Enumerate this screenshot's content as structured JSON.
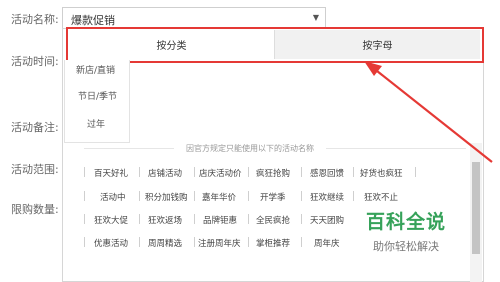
{
  "form": {
    "labels": {
      "activity_name": "活动名称:",
      "activity_time": "活动时间:",
      "activity_remark": "活动备注:",
      "activity_scope": "活动范围:",
      "limit_quantity": "限购数量:"
    },
    "activity_select_value": "爆款促销"
  },
  "tabs": [
    {
      "label": "按分类"
    },
    {
      "label": "按字母"
    }
  ],
  "categories": [
    "新店/直销",
    "节日/季节",
    "过年"
  ],
  "section_title": "因官方规定只能使用以下的活动名称",
  "tag_rows": [
    [
      "百天好礼",
      "店铺活动",
      "店庆活动价",
      "疯狂抢购",
      "感恩回馈",
      "好货也疯狂"
    ],
    [
      "活动中",
      "积分加钱购",
      "嘉年华价",
      "开学季",
      "狂欢继续",
      "狂欢不止"
    ],
    [
      "狂欢大促",
      "狂欢返场",
      "品牌钜惠",
      "全民疯抢",
      "天天团购",
      ""
    ],
    [
      "优惠活动",
      "周周精选",
      "注册周年庆",
      "掌柜推荐",
      "周年庆",
      ""
    ]
  ],
  "watermark": {
    "title": "百科全说",
    "subtitle": "助你轻松解决"
  },
  "colors": {
    "annotation_red": "#e53935",
    "watermark_green": "#36a25a"
  }
}
